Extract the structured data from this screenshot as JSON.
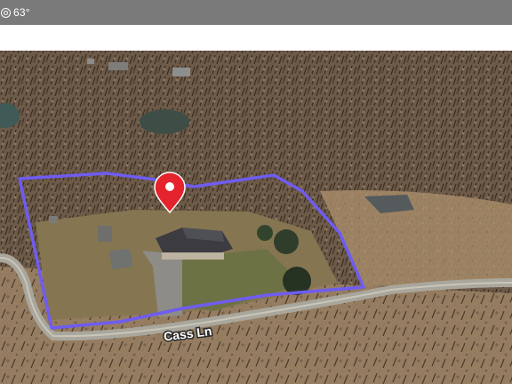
{
  "status_bar": {
    "icon": "weather-location-icon",
    "temperature": "63°"
  },
  "map": {
    "view": "satellite-3d",
    "road_label": "Cass Ln",
    "pin_icon": "location-pin-icon",
    "boundary_color": "#6f5cf0",
    "pin_color": "#e5232d"
  }
}
